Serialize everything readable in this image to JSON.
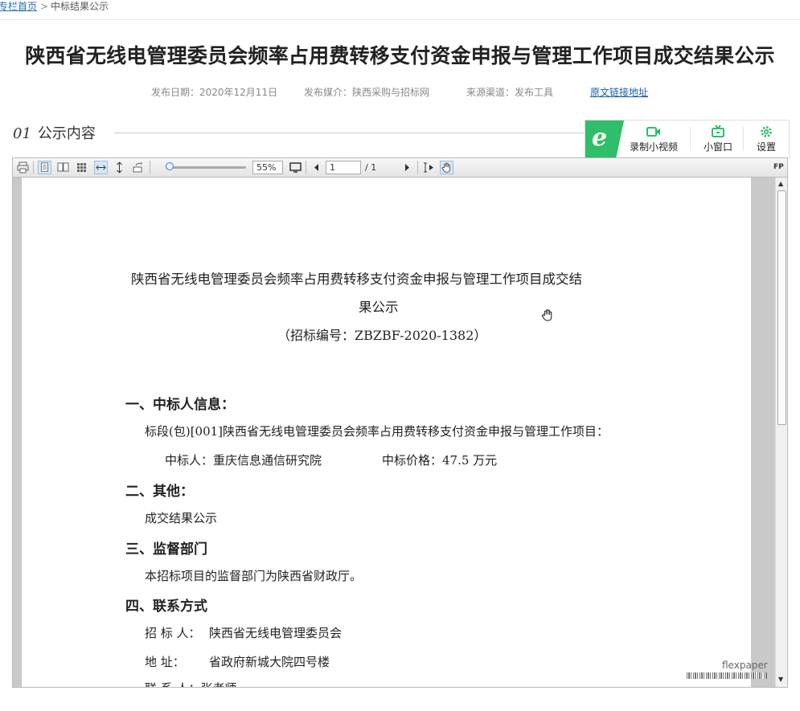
{
  "breadcrumb": {
    "home": "专栏首页",
    "separator": ">",
    "current": "中标结果公示"
  },
  "title": "陕西省无线电管理委员会频率占用费转移支付资金申报与管理工作项目成交结果公示",
  "meta": {
    "publish_date": "发布日期：2020年12月11日",
    "media": "发布媒介：陕西采购与招标网",
    "channel": "来源渠道：发布工具",
    "source_link": "原文链接地址"
  },
  "section": {
    "number": "01",
    "label": "公示内容"
  },
  "plugin": {
    "record_label": "录制小视频",
    "miniwin_label": "小窗口",
    "settings_label": "设置",
    "accent": "#2fbe69"
  },
  "viewer": {
    "zoom": "55%",
    "zoom_level": 0.05,
    "page_current": "1",
    "page_total": "/ 1",
    "fp_label": "FP",
    "watermark": "flexpaper"
  },
  "doc": {
    "title_line1": "陕西省无线电管理委员会频率占用费转移支付资金申报与管理工作项目成交结",
    "title_line2": "果公示",
    "code": "（招标编号：ZBZBF-2020-1382）",
    "h1": "一、中标人信息：",
    "lot": "标段(包)[001]陕西省无线电管理委员会频率占用费转移支付资金申报与管理工作项目：",
    "winner": "中标人：重庆信息通信研究院",
    "price": "中标价格：47.5 万元",
    "h2": "二、其他：",
    "other": "成交结果公示",
    "h3": "三、监督部门",
    "supervisor": "本招标项目的监督部门为陕西省财政厅。",
    "h4": "四、联系方式",
    "tenderer_label": "招 标 人：",
    "tenderer": "陕西省无线电管理委员会",
    "address_label": "地      址：",
    "address": "省政府新城大院四号楼",
    "contact_partial": "联 系 人：张老师"
  }
}
